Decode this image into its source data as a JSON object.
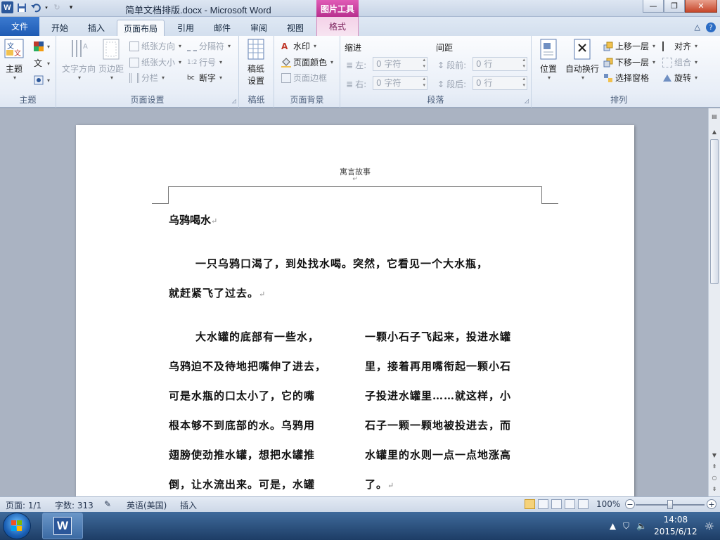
{
  "window": {
    "title": "简单文档排版.docx - Microsoft Word",
    "context_header": "图片工具",
    "minimize": "—",
    "maximize": "❐",
    "close": "✕"
  },
  "tabs": [
    "文件",
    "开始",
    "插入",
    "页面布局",
    "引用",
    "邮件",
    "审阅",
    "视图",
    "格式"
  ],
  "ribbon": {
    "theme_group": {
      "label": "主题",
      "theme_btn": "主题"
    },
    "page_setup": {
      "label": "页面设置",
      "text_direction": "文字方向",
      "margins": "页边距",
      "orientation": "纸张方向",
      "size": "纸张大小",
      "columns": "分栏",
      "breaks": "分隔符",
      "line_numbers": "行号",
      "hyphenation": "断字"
    },
    "manuscript": {
      "label": "稿纸",
      "btn_line1": "稿纸",
      "btn_line2": "设置"
    },
    "page_background": {
      "label": "页面背景",
      "watermark": "水印",
      "page_color": "页面颜色",
      "page_borders": "页面边框"
    },
    "paragraph": {
      "label": "段落",
      "indent": "缩进",
      "spacing": "间距",
      "left_label": "左:",
      "right_label": "右:",
      "before_label": "段前:",
      "after_label": "段后:",
      "left_value": "0 字符",
      "right_value": "0 字符",
      "before_value": "0 行",
      "after_value": "0 行"
    },
    "arrange": {
      "label": "排列",
      "position": "位置",
      "wrap_text": "自动换行",
      "bring_forward": "上移一层",
      "send_backward": "下移一层",
      "selection_pane": "选择窗格",
      "align": "对齐",
      "group": "组合",
      "rotate": "旋转"
    }
  },
  "document": {
    "header": "寓言故事",
    "title": "乌鸦喝水",
    "para1_line1": "一只乌鸦口渴了，到处找水喝。突然，它看见一个大水瓶，",
    "para1_line2": "就赶紧飞了过去。",
    "left_col": [
      "大水罐的底部有一些水，",
      "乌鸦迫不及待地把嘴伸了进去，",
      "可是水瓶的口太小了，它的嘴",
      "根本够不到底部的水。乌鸦用",
      "翅膀使劲推水罐，想把水罐推",
      "倒，让水流出来。可是，水罐"
    ],
    "right_col": [
      "一颗小石子飞起来，投进水罐",
      "里，接着再用嘴衔起一颗小石",
      "子投进水罐里……就这样，小",
      "石子一颗一颗地被投进去，而",
      "水罐里的水则一点一点地涨高",
      "了。"
    ],
    "paragraph_mark": "↵"
  },
  "status": {
    "page": "页面: 1/1",
    "words": "字数: 313",
    "language": "英语(美国)",
    "mode": "插入",
    "zoom": "100%",
    "zoom_level": 1.0
  },
  "taskbar": {
    "time": "14:08",
    "date": "2015/6/12"
  },
  "colors": {
    "file_tab": "#2b63b8",
    "context_tab": "#c8409f",
    "accent": "#2b579a"
  }
}
